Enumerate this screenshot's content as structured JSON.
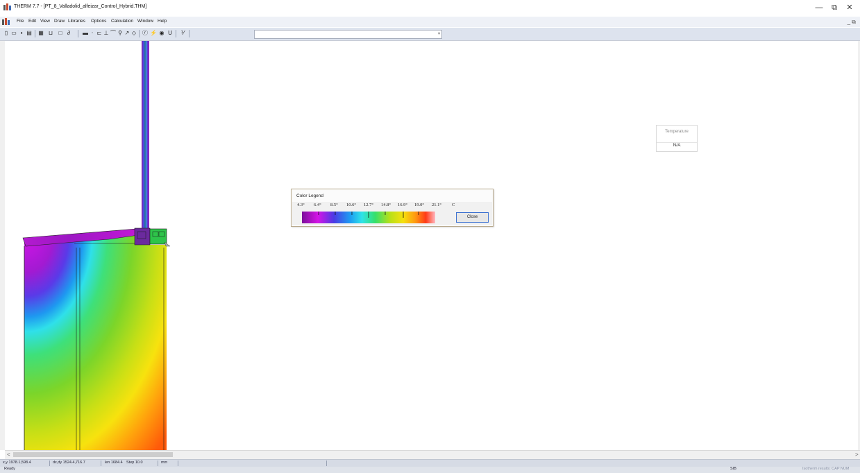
{
  "window": {
    "title": "THERM 7.7 - [PT_8_Valladolid_alfeizar_Control_Hybrid.THM]",
    "minimize_glyph": "—",
    "restore_glyph": "⧉",
    "close_glyph": "✕",
    "mdi_controls": "_ ⧉"
  },
  "menu": {
    "items": [
      "File",
      "Edit",
      "View",
      "Draw",
      "Libraries",
      "Options",
      "Calculation",
      "Window",
      "Help"
    ]
  },
  "toolbar": {
    "combo_value": "",
    "combo_arrow": "▾"
  },
  "legend": {
    "title": "Color Legend",
    "ticks": [
      "4.3°",
      "6.4°",
      "8.5°",
      "10.6°",
      "12.7°",
      "14.8°",
      "16.9°",
      "19.0°",
      "21.1°"
    ],
    "unit": "C",
    "close_label": "Close"
  },
  "temperature_box": {
    "title": "Temperature",
    "value": "N/A"
  },
  "scrollbar": {
    "left_arrow": "<",
    "right_arrow": ">"
  },
  "status": {
    "xy": "x,y 1978.1,598.4",
    "dxdy": "dx,dy 1524.4,716.7",
    "len": "len 1684.4",
    "step": "Step 10.0",
    "unit": "mm",
    "ready": "Ready",
    "mode": "SIB",
    "result": "Isotherm results: CAP NUM"
  },
  "colors": {
    "menubar": "#eef1f7",
    "toolbar": "#dde3ee",
    "status": "#d6dbe5",
    "legend_border": "#b8a98c",
    "close_focus": "#3a6fd0"
  }
}
